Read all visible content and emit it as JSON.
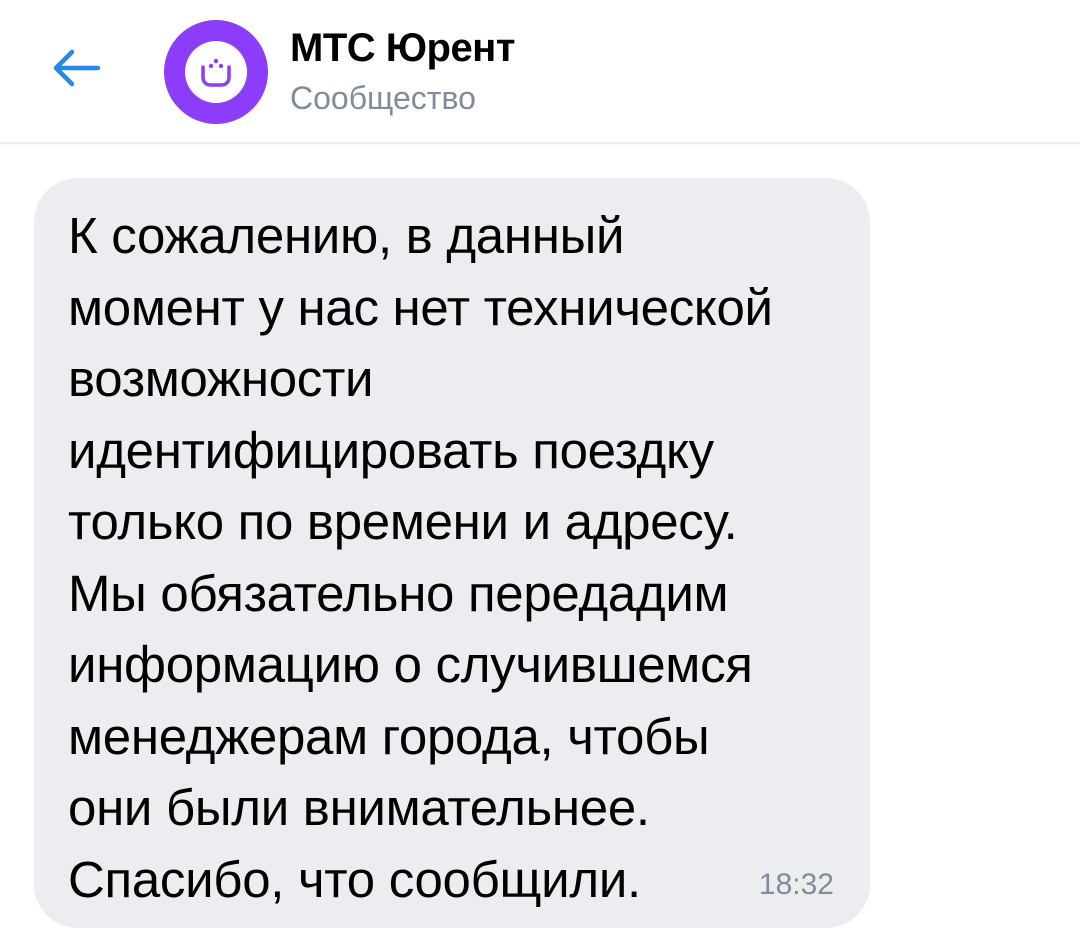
{
  "header": {
    "title": "МТС Юрент",
    "subtitle": "Сообщество",
    "back_icon": "arrow-left-icon",
    "avatar_icon": "urent-logo",
    "accent_color": "#2688eb",
    "avatar_color": "#8b3dfb"
  },
  "message": {
    "text": "К сожалению, в данный\nмомент у нас нет технической\nвозможности\nидентифицировать поездку\nтолько по времени и адресу.\nМы обязательно передадим\nинформацию о случившемся\nменеджерам города, чтобы\nони были внимательнее.\nСпасибо, что сообщили.",
    "time": "18:32",
    "bubble_color": "#ebedf0"
  }
}
